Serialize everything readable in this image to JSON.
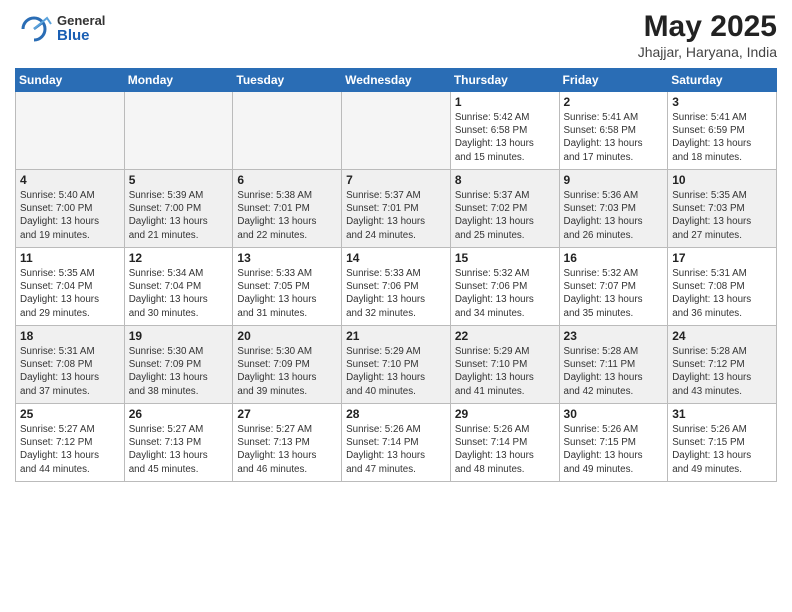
{
  "header": {
    "logo_general": "General",
    "logo_blue": "Blue",
    "month": "May 2025",
    "location": "Jhajjar, Haryana, India"
  },
  "days_of_week": [
    "Sunday",
    "Monday",
    "Tuesday",
    "Wednesday",
    "Thursday",
    "Friday",
    "Saturday"
  ],
  "weeks": [
    [
      {
        "day": "",
        "info": "",
        "empty": true
      },
      {
        "day": "",
        "info": "",
        "empty": true
      },
      {
        "day": "",
        "info": "",
        "empty": true
      },
      {
        "day": "",
        "info": "",
        "empty": true
      },
      {
        "day": "1",
        "info": "Sunrise: 5:42 AM\nSunset: 6:58 PM\nDaylight: 13 hours\nand 15 minutes."
      },
      {
        "day": "2",
        "info": "Sunrise: 5:41 AM\nSunset: 6:58 PM\nDaylight: 13 hours\nand 17 minutes."
      },
      {
        "day": "3",
        "info": "Sunrise: 5:41 AM\nSunset: 6:59 PM\nDaylight: 13 hours\nand 18 minutes."
      }
    ],
    [
      {
        "day": "4",
        "info": "Sunrise: 5:40 AM\nSunset: 7:00 PM\nDaylight: 13 hours\nand 19 minutes."
      },
      {
        "day": "5",
        "info": "Sunrise: 5:39 AM\nSunset: 7:00 PM\nDaylight: 13 hours\nand 21 minutes."
      },
      {
        "day": "6",
        "info": "Sunrise: 5:38 AM\nSunset: 7:01 PM\nDaylight: 13 hours\nand 22 minutes."
      },
      {
        "day": "7",
        "info": "Sunrise: 5:37 AM\nSunset: 7:01 PM\nDaylight: 13 hours\nand 24 minutes."
      },
      {
        "day": "8",
        "info": "Sunrise: 5:37 AM\nSunset: 7:02 PM\nDaylight: 13 hours\nand 25 minutes."
      },
      {
        "day": "9",
        "info": "Sunrise: 5:36 AM\nSunset: 7:03 PM\nDaylight: 13 hours\nand 26 minutes."
      },
      {
        "day": "10",
        "info": "Sunrise: 5:35 AM\nSunset: 7:03 PM\nDaylight: 13 hours\nand 27 minutes."
      }
    ],
    [
      {
        "day": "11",
        "info": "Sunrise: 5:35 AM\nSunset: 7:04 PM\nDaylight: 13 hours\nand 29 minutes."
      },
      {
        "day": "12",
        "info": "Sunrise: 5:34 AM\nSunset: 7:04 PM\nDaylight: 13 hours\nand 30 minutes."
      },
      {
        "day": "13",
        "info": "Sunrise: 5:33 AM\nSunset: 7:05 PM\nDaylight: 13 hours\nand 31 minutes."
      },
      {
        "day": "14",
        "info": "Sunrise: 5:33 AM\nSunset: 7:06 PM\nDaylight: 13 hours\nand 32 minutes."
      },
      {
        "day": "15",
        "info": "Sunrise: 5:32 AM\nSunset: 7:06 PM\nDaylight: 13 hours\nand 34 minutes."
      },
      {
        "day": "16",
        "info": "Sunrise: 5:32 AM\nSunset: 7:07 PM\nDaylight: 13 hours\nand 35 minutes."
      },
      {
        "day": "17",
        "info": "Sunrise: 5:31 AM\nSunset: 7:08 PM\nDaylight: 13 hours\nand 36 minutes."
      }
    ],
    [
      {
        "day": "18",
        "info": "Sunrise: 5:31 AM\nSunset: 7:08 PM\nDaylight: 13 hours\nand 37 minutes."
      },
      {
        "day": "19",
        "info": "Sunrise: 5:30 AM\nSunset: 7:09 PM\nDaylight: 13 hours\nand 38 minutes."
      },
      {
        "day": "20",
        "info": "Sunrise: 5:30 AM\nSunset: 7:09 PM\nDaylight: 13 hours\nand 39 minutes."
      },
      {
        "day": "21",
        "info": "Sunrise: 5:29 AM\nSunset: 7:10 PM\nDaylight: 13 hours\nand 40 minutes."
      },
      {
        "day": "22",
        "info": "Sunrise: 5:29 AM\nSunset: 7:10 PM\nDaylight: 13 hours\nand 41 minutes."
      },
      {
        "day": "23",
        "info": "Sunrise: 5:28 AM\nSunset: 7:11 PM\nDaylight: 13 hours\nand 42 minutes."
      },
      {
        "day": "24",
        "info": "Sunrise: 5:28 AM\nSunset: 7:12 PM\nDaylight: 13 hours\nand 43 minutes."
      }
    ],
    [
      {
        "day": "25",
        "info": "Sunrise: 5:27 AM\nSunset: 7:12 PM\nDaylight: 13 hours\nand 44 minutes."
      },
      {
        "day": "26",
        "info": "Sunrise: 5:27 AM\nSunset: 7:13 PM\nDaylight: 13 hours\nand 45 minutes."
      },
      {
        "day": "27",
        "info": "Sunrise: 5:27 AM\nSunset: 7:13 PM\nDaylight: 13 hours\nand 46 minutes."
      },
      {
        "day": "28",
        "info": "Sunrise: 5:26 AM\nSunset: 7:14 PM\nDaylight: 13 hours\nand 47 minutes."
      },
      {
        "day": "29",
        "info": "Sunrise: 5:26 AM\nSunset: 7:14 PM\nDaylight: 13 hours\nand 48 minutes."
      },
      {
        "day": "30",
        "info": "Sunrise: 5:26 AM\nSunset: 7:15 PM\nDaylight: 13 hours\nand 49 minutes."
      },
      {
        "day": "31",
        "info": "Sunrise: 5:26 AM\nSunset: 7:15 PM\nDaylight: 13 hours\nand 49 minutes."
      }
    ]
  ]
}
